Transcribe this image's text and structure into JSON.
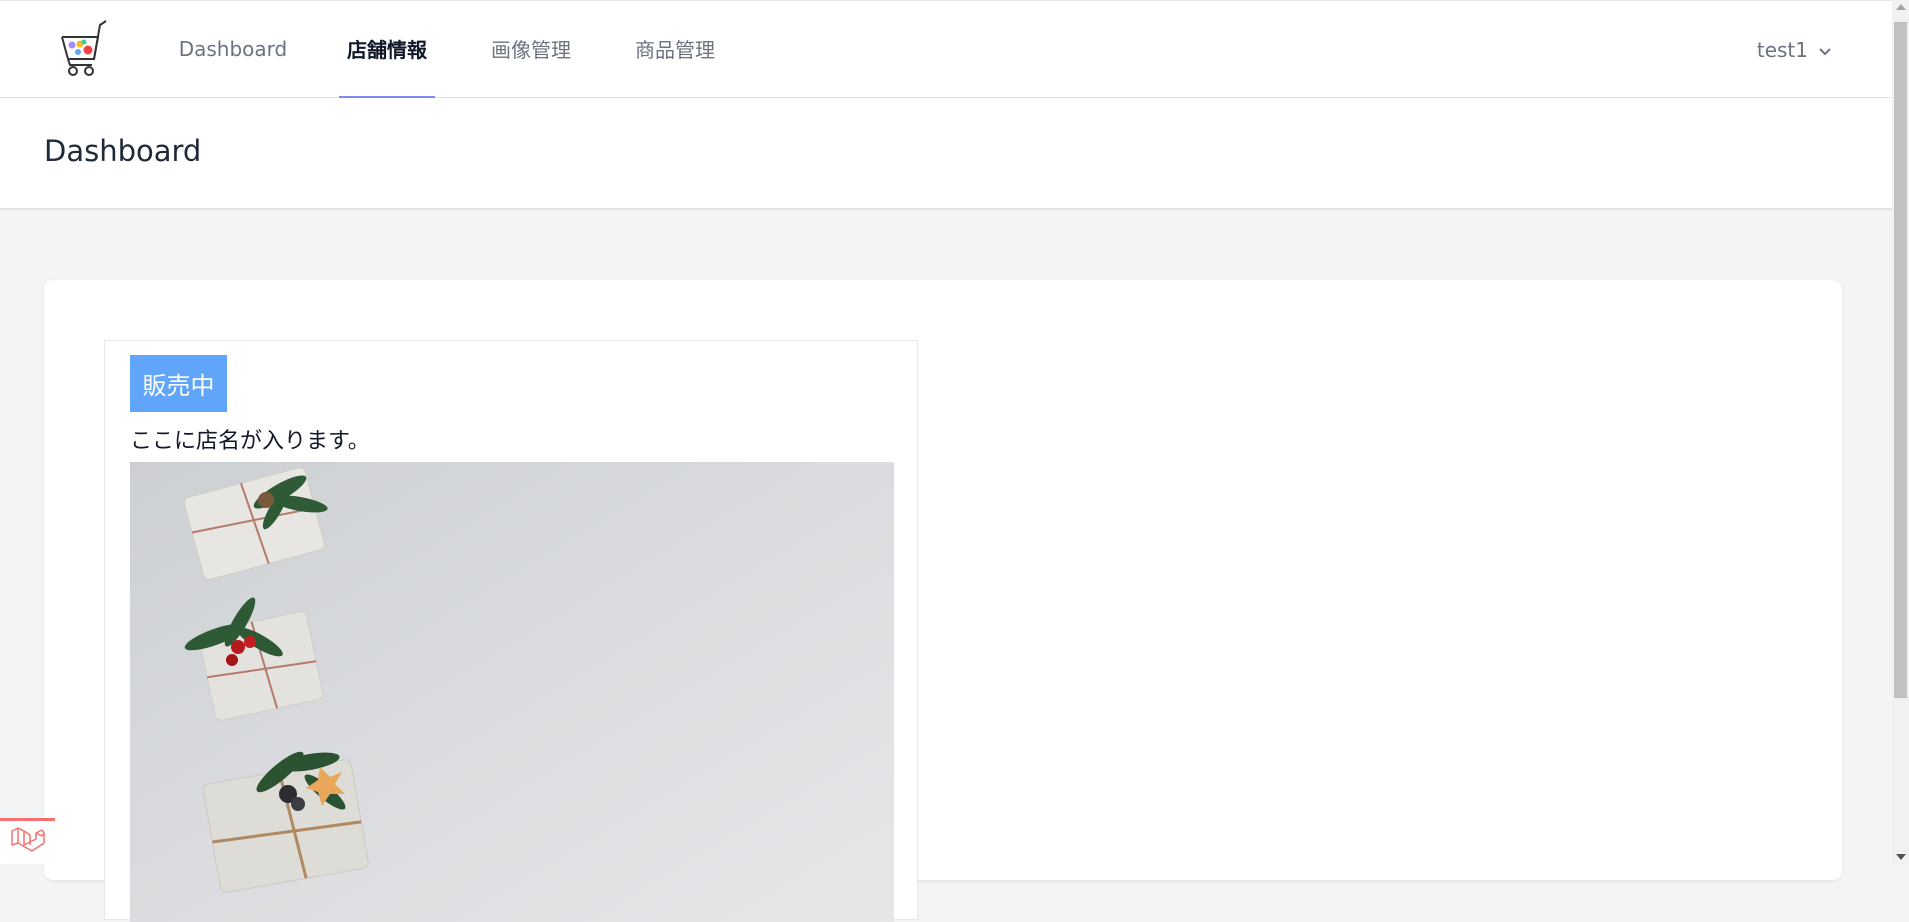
{
  "nav": {
    "logo_icon": "shopping-cart-icon",
    "links": [
      {
        "label": "Dashboard",
        "active": false
      },
      {
        "label": "店舗情報",
        "active": true
      },
      {
        "label": "画像管理",
        "active": false
      },
      {
        "label": "商品管理",
        "active": false
      }
    ],
    "user": {
      "name": "test1",
      "icon": "chevron-down-icon"
    },
    "accent_color": "#818cf8"
  },
  "header": {
    "title": "Dashboard"
  },
  "shop": {
    "status": "販売中",
    "status_color": "#60a5fa",
    "name": "ここに店名が入ります。",
    "image": "gift-boxes-photo"
  },
  "debug": {
    "icon": "laravel-icon",
    "color": "#f87171"
  }
}
